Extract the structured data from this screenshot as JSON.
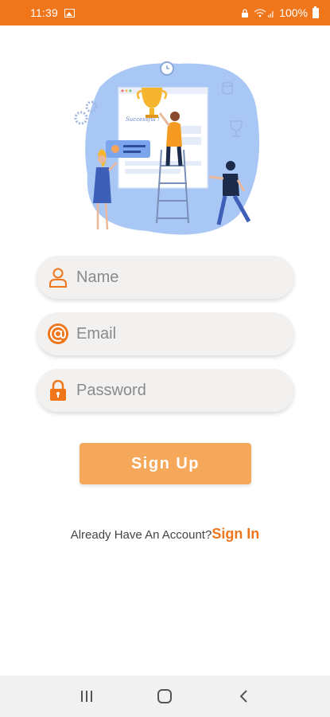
{
  "status_bar": {
    "time": "11:39",
    "battery": "100%"
  },
  "form": {
    "name_placeholder": "Name",
    "email_placeholder": "Email",
    "password_placeholder": "Password",
    "signup_label": "Sign Up"
  },
  "footer": {
    "prompt": "Already Have An Account?",
    "signin_label": "Sign In"
  },
  "illustration": {
    "caption": "Successful !"
  },
  "colors": {
    "accent": "#f0761c",
    "button": "#f5a85a",
    "field_bg": "#f3f1ef",
    "illustration_bg": "#a9c7f5"
  },
  "icons": [
    "gallery-icon",
    "wifi-icon",
    "lock-status-icon",
    "battery-icon",
    "user-icon",
    "at-icon",
    "padlock-icon",
    "recents-icon",
    "home-icon",
    "back-icon"
  ]
}
